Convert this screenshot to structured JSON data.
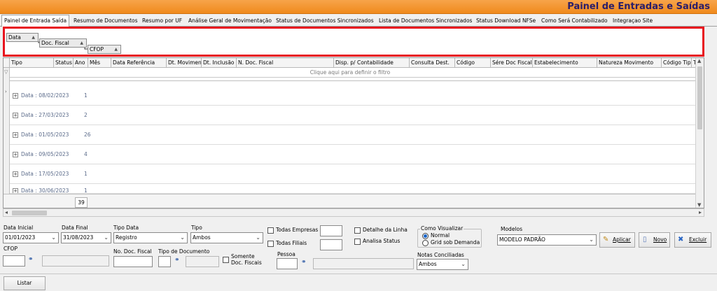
{
  "window": {
    "title": "Painel de Entradas e Saídas"
  },
  "tabs": [
    "Painel de Entrada Saída",
    "Resumo de Documentos",
    "Resumo por UF",
    "Análise Geral de Movimentação",
    "Status de Documentos Sincronizados",
    "Lista de Documentos Sincronizados",
    "Status Download NFSe",
    "Como Será Contabilizado",
    "Integraçao Site"
  ],
  "group_panel": {
    "items": [
      "Data",
      "Doc. Fiscal",
      "CFOP"
    ]
  },
  "grid": {
    "columns": [
      "Tipo",
      "Status",
      "Ano",
      "Mês",
      "Data Referência",
      "Dt. Movimen",
      "Dt. Inclusão",
      "N. Doc. Fiscal",
      "Disp. p/ Contabilidade",
      "Consulta Dest.",
      "Código",
      "Sére Doc Fiscal",
      "Estabelecimento",
      "Natureza Movimento",
      "Código Tipo",
      "Ti"
    ],
    "filter_hint": "Clique aqui para definir o filtro",
    "rows": [
      {
        "label": "Data : 08/02/2023",
        "count": "1"
      },
      {
        "label": "Data : 27/03/2023",
        "count": "2"
      },
      {
        "label": "Data : 01/05/2023",
        "count": "26"
      },
      {
        "label": "Data : 09/05/2023",
        "count": "4"
      },
      {
        "label": "Data : 17/05/2023",
        "count": "1"
      },
      {
        "label": "Data : 30/06/2023",
        "count": "1"
      }
    ],
    "total": "39"
  },
  "filters": {
    "data_inicial_label": "Data Inicial",
    "data_inicial": "01/01/2023",
    "data_final_label": "Data Final",
    "data_final": "31/08/2023",
    "tipo_data_label": "Tipo Data",
    "tipo_data": "Registro",
    "tipo_label": "Tipo",
    "tipo": "Ambos",
    "todas_empresas": "Todas Empresas",
    "todas_filiais": "Todas Filiais",
    "detalhe_linha": "Detalhe da Linha",
    "analisa_status": "Analisa Status",
    "como_visualizar_label": "Como Visualizar",
    "visualizar_normal": "Normal",
    "visualizar_grid": "Grid sob Demanda",
    "modelos_label": "Modelos",
    "modelo": "MODELO PADRÃO",
    "cfop_label": "CFOP",
    "no_doc_fiscal_label": "No. Doc. Fiscal",
    "tipo_documento_label": "Tipo de Documento",
    "somente_doc_fiscais": "Somente\nDoc. Fiscais",
    "pessoa_label": "Pessoa",
    "notas_conciliadas_label": "Notas Conciliadas",
    "notas_conciliadas": "Ambos"
  },
  "buttons": {
    "aplicar": "Aplicar",
    "novo": "Novo",
    "excluir": "Excluir",
    "listar": "Listar"
  }
}
